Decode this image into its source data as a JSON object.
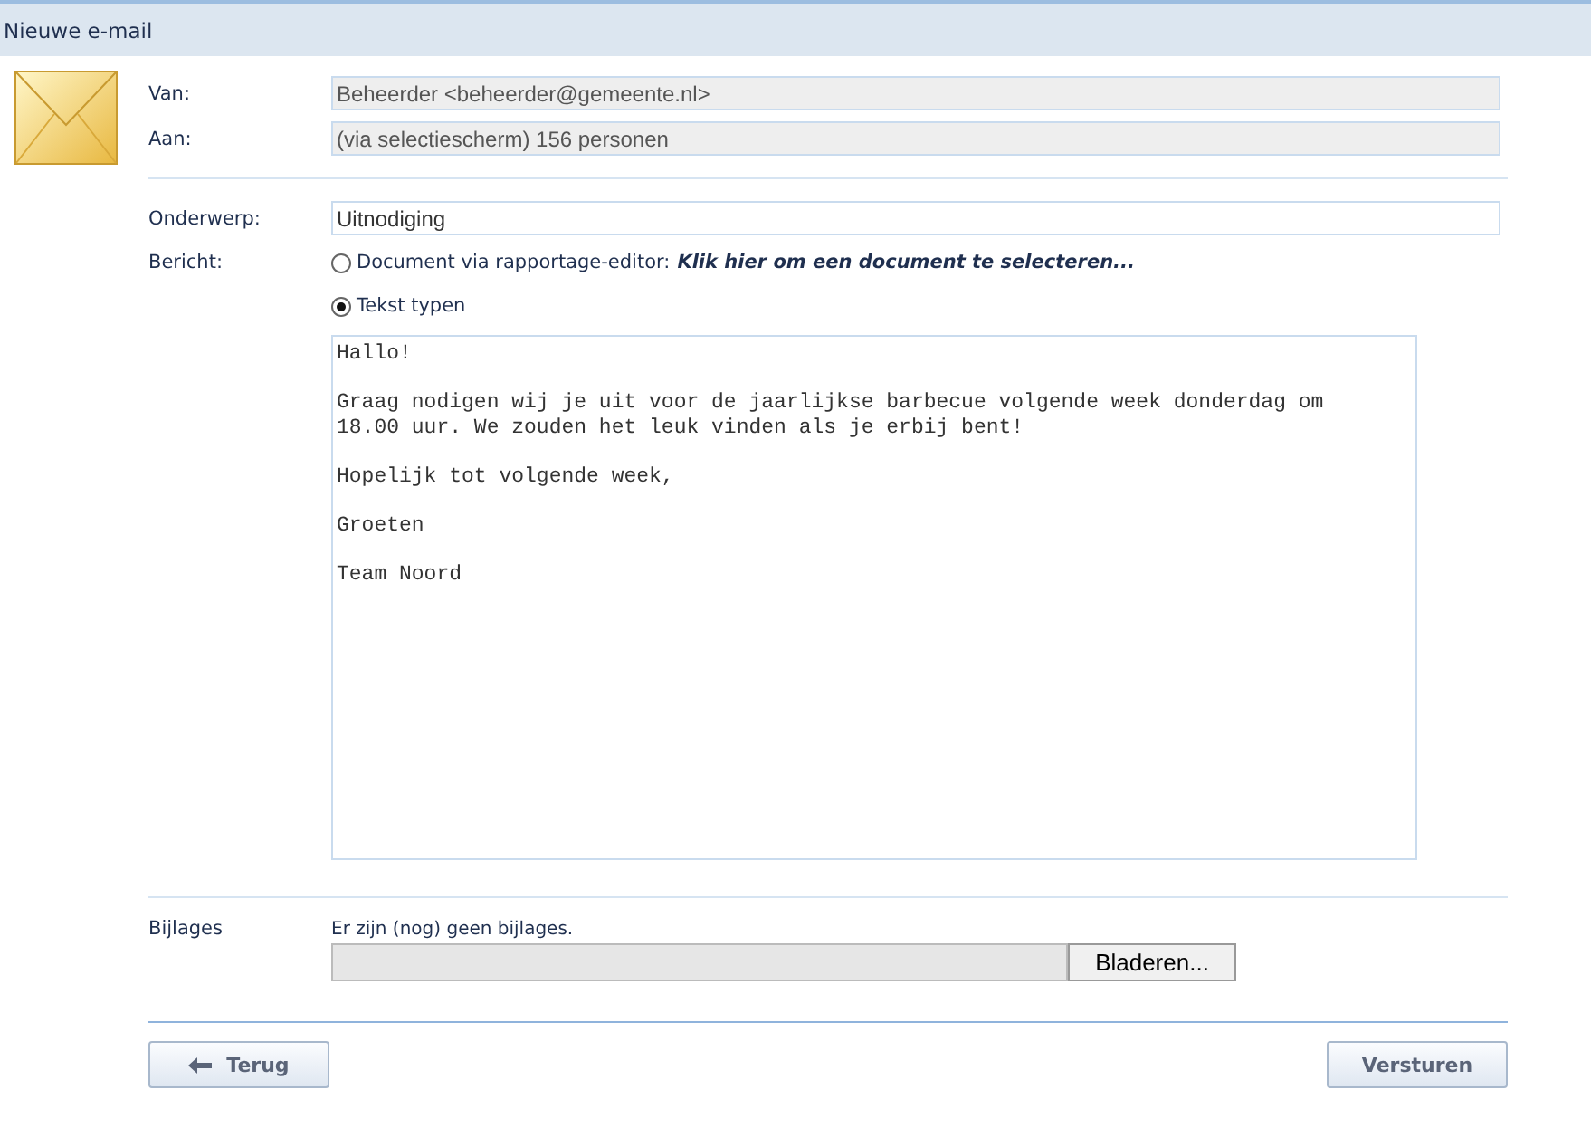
{
  "window": {
    "title": "Nieuwe e-mail"
  },
  "from": {
    "label": "Van:",
    "value": "Beheerder <beheerder@gemeente.nl>"
  },
  "to": {
    "label": "Aan:",
    "value": "(via selectiescherm) 156 personen"
  },
  "subject": {
    "label": "Onderwerp:",
    "value": "Uitnodiging"
  },
  "message": {
    "label": "Bericht:",
    "options": [
      {
        "label": "Document via rapportage-editor:",
        "link": "Klik hier om een document te selecteren...",
        "selected": false
      },
      {
        "label": "Tekst typen",
        "selected": true
      }
    ],
    "text": "Hallo!\n\nGraag nodigen wij je uit voor de jaarlijkse barbecue volgende week donderdag om\n18.00 uur. We zouden het leuk vinden als je erbij bent!\n\nHopelijk tot volgende week,\n\nGroeten\n\nTeam Noord"
  },
  "attachments": {
    "label": "Bijlages",
    "status": "Er zijn (nog) geen bijlages.",
    "browse_button": "Bladeren..."
  },
  "buttons": {
    "back": "Terug",
    "send": "Versturen"
  }
}
